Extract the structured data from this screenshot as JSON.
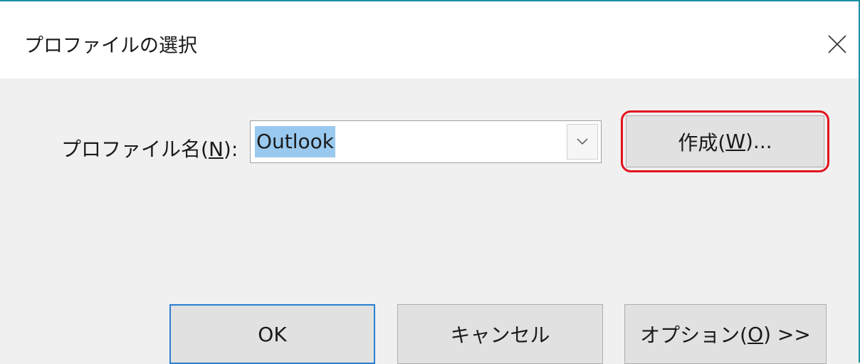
{
  "window": {
    "title": "プロファイルの選択"
  },
  "profile": {
    "label_prefix": "プロファイル名(",
    "label_key": "N",
    "label_suffix": "):",
    "selected": "Outlook"
  },
  "buttons": {
    "create": {
      "prefix": "作成(",
      "key": "W",
      "suffix": ")..."
    },
    "ok": "OK",
    "cancel": "キャンセル",
    "options": {
      "prefix": "オプション(",
      "key": "O",
      "suffix": ") >>"
    }
  },
  "icons": {
    "close": "close-icon",
    "dropdown": "chevron-down-icon"
  },
  "colors": {
    "accent_border": "#1e8fa3",
    "highlight_red": "#e2121e",
    "selection": "#99c9ef",
    "default_button_border": "#2a7fd1"
  }
}
